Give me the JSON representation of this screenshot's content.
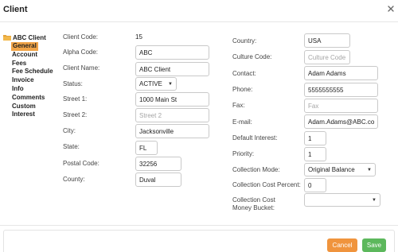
{
  "dialog": {
    "title": "Client"
  },
  "tree": {
    "root_label": "ABC Client",
    "items": [
      {
        "label": "General",
        "active": true
      },
      {
        "label": "Account"
      },
      {
        "label": "Fees"
      },
      {
        "label": "Fee Schedule"
      },
      {
        "label": "Invoice"
      },
      {
        "label": "Info"
      },
      {
        "label": "Comments"
      },
      {
        "label": "Custom"
      },
      {
        "label": "Interest"
      }
    ]
  },
  "form_left": {
    "client_code": {
      "label": "Client Code:",
      "value": "15"
    },
    "alpha_code": {
      "label": "Alpha Code:",
      "value": "ABC"
    },
    "client_name": {
      "label": "Client Name:",
      "value": "ABC Client"
    },
    "status": {
      "label": "Status:",
      "value": "ACTIVE"
    },
    "street1": {
      "label": "Street 1:",
      "value": "1000 Main St"
    },
    "street2": {
      "label": "Street 2:",
      "placeholder": "Street 2"
    },
    "city": {
      "label": "City:",
      "value": "Jacksonville"
    },
    "state": {
      "label": "State:",
      "value": "FL"
    },
    "postal_code": {
      "label": "Postal Code:",
      "value": "32256"
    },
    "county": {
      "label": "County:",
      "value": "Duval"
    }
  },
  "form_right": {
    "country": {
      "label": "Country:",
      "value": "USA"
    },
    "culture_code": {
      "label": "Culture Code:",
      "placeholder": "Culture Code"
    },
    "contact": {
      "label": "Contact:",
      "value": "Adam Adams"
    },
    "phone": {
      "label": "Phone:",
      "value": "5555555555"
    },
    "fax": {
      "label": "Fax:",
      "placeholder": "Fax"
    },
    "email": {
      "label": "E-mail:",
      "value": "Adam.Adams@ABC.com"
    },
    "default_interest": {
      "label": "Default Interest:",
      "value": "1"
    },
    "priority": {
      "label": "Priority:",
      "value": "1"
    },
    "collection_mode": {
      "label": "Collection Mode:",
      "value": "Original Balance"
    },
    "collection_cost_percent": {
      "label": "Collection Cost Percent:",
      "value": "0"
    },
    "collection_cost_money_bucket": {
      "label": "Collection Cost Money Bucket:",
      "value": ""
    }
  },
  "footer": {
    "cancel_label": "Cancel",
    "save_label": "Save"
  },
  "icons": {
    "close": "close-icon",
    "folder": "folder-icon",
    "caret": "chevron-down-icon"
  },
  "colors": {
    "accent": "#f0a347",
    "cancel": "#f0943d",
    "save": "#5cb85c"
  }
}
